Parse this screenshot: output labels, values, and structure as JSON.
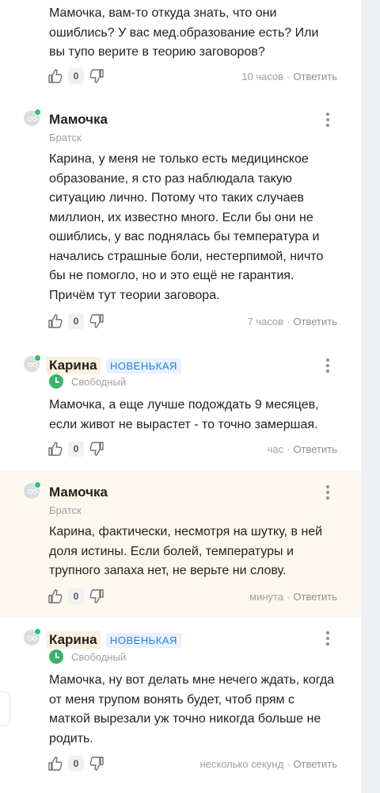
{
  "comments": [
    {
      "body": "Мамочка, вам-то откуда знать, что они ошиблись? У вас мед.образование есть? Или вы тупо верите в теорию заговоров?",
      "likes": "0",
      "time": "10 часов",
      "reply": "Ответить"
    },
    {
      "author": "Мамочка",
      "city": "Братск",
      "body": "Карина, у меня не только есть медицинское образование, я сто раз наблюдала такую ситуацию лично. Потому что таких случаев миллион, их известно много. Если бы они не ошиблись, у вас поднялась бы температура и начались страшные боли, нестерпимой, ничто бы не помогло, но и это ещё не гарантия. Причём тут теории заговора.",
      "likes": "0",
      "time": "7 часов",
      "reply": "Ответить"
    },
    {
      "author": "Карина",
      "badge": "НОВЕНЬКАЯ",
      "status": "Свободный",
      "body": "Мамочка, а еще лучше подождать 9 месяцев, если живот не вырастет - то точно замершая.",
      "likes": "0",
      "time": "час",
      "reply": "Ответить"
    },
    {
      "author": "Мамочка",
      "city": "Братск",
      "body": "Карина, фактически, несмотря на шутку, в ней доля истины. Если болей, температуры и трупного запаха нет, не верьте ни слову.",
      "likes": "0",
      "time": "минута",
      "reply": "Ответить"
    },
    {
      "author": "Карина",
      "badge": "НОВЕНЬКАЯ",
      "status": "Свободный",
      "body": "Мамочка, ну вот делать мне нечего ждать, когда от меня трупом вонять будет, чтоб прям с маткой вырезали уж точно никогда больше не родить.",
      "likes": "0",
      "time": "несколько секунд",
      "reply": "Ответить"
    }
  ],
  "separator": "·"
}
